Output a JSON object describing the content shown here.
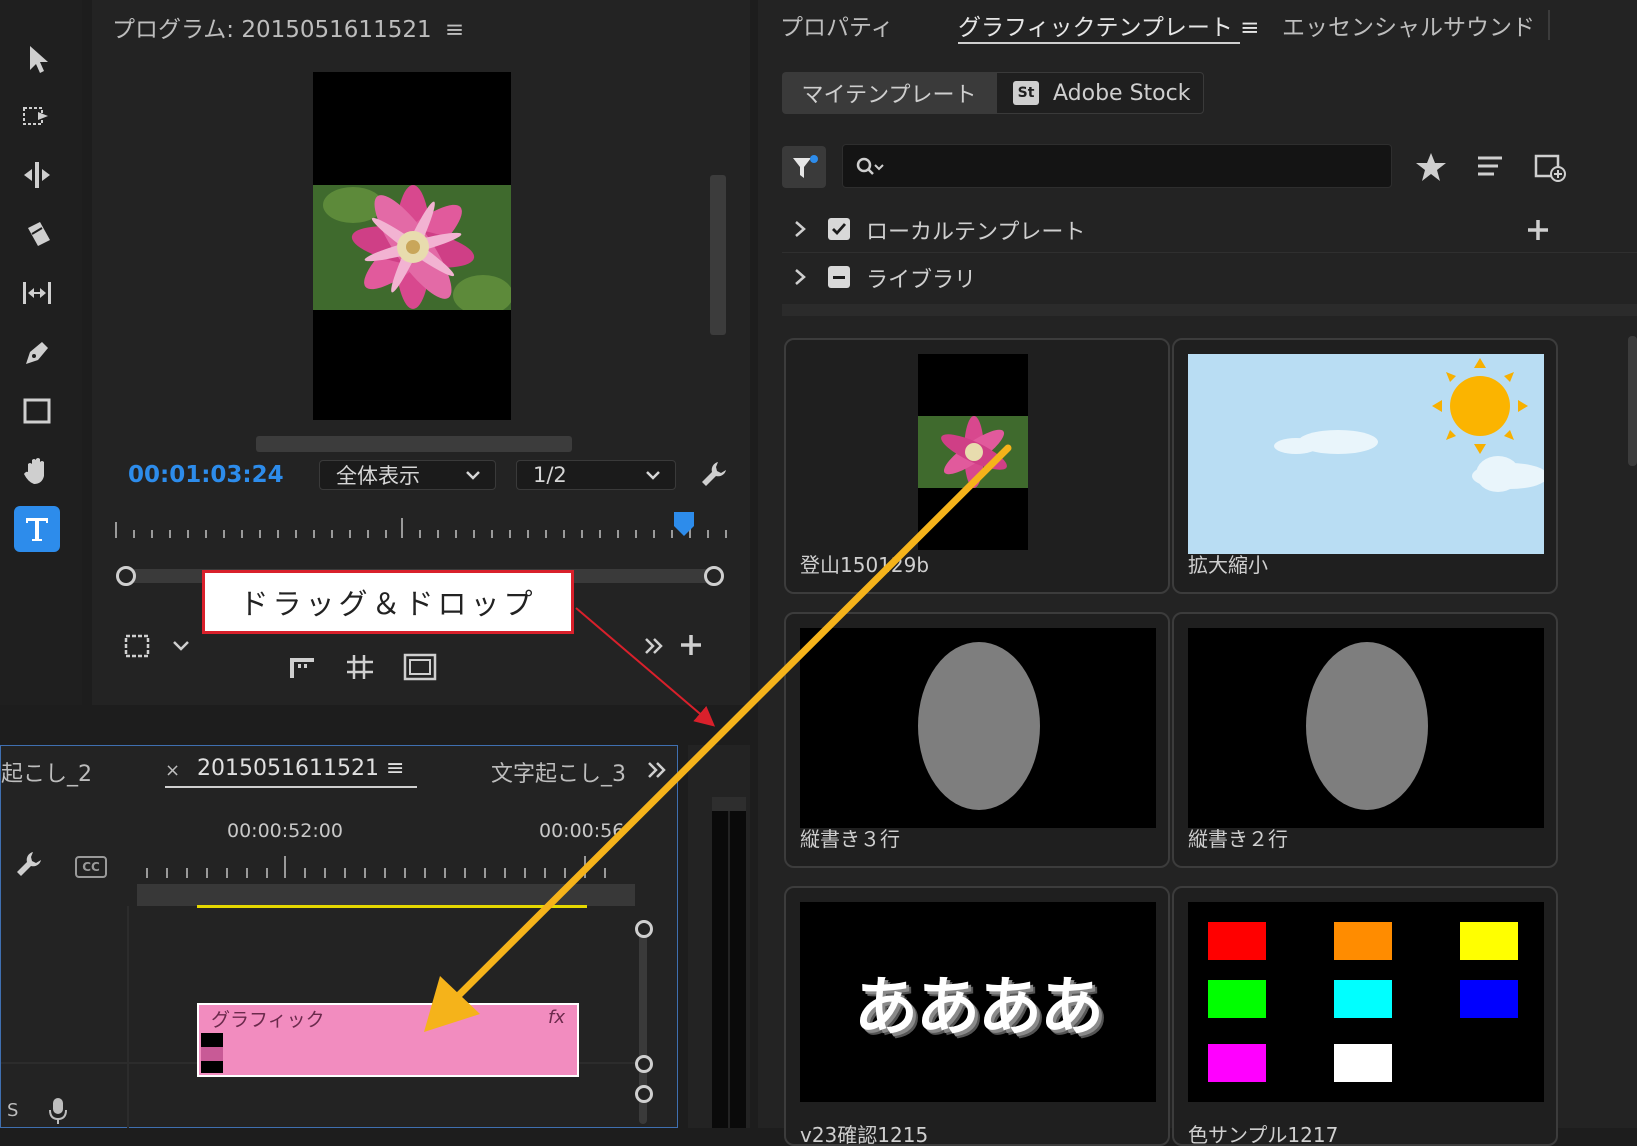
{
  "program_monitor": {
    "title": "プログラム: 2015051611521",
    "timecode": "00:01:03:24",
    "zoom_select": "全体表示",
    "resolution_select": "1/2"
  },
  "panel_tabs": {
    "properties": "プロパティ",
    "graphics_templates": "グラフィックテンプレート",
    "essential_sound": "エッセンシャルサウンド"
  },
  "template_source": {
    "my_templates": "マイテンプレート",
    "adobe_stock_badge": "St",
    "adobe_stock": "Adobe Stock"
  },
  "search": {
    "placeholder": ""
  },
  "folders": [
    {
      "label": "ローカルテンプレート"
    },
    {
      "label": "ライブラリ"
    }
  ],
  "templates": [
    {
      "label": "登山150129b"
    },
    {
      "label": "拡大縮小"
    },
    {
      "label": "縦書き３行"
    },
    {
      "label": "縦書き２行"
    },
    {
      "label": "v23確認1215",
      "thumb_text": "ああああ"
    },
    {
      "label": "色サンプル1217"
    }
  ],
  "timeline": {
    "tab_left": "起こし_2",
    "tab_active": "2015051611521",
    "tab_right": "文字起こし_3",
    "ruler_time_1": "00:00:52:00",
    "ruler_time_2": "00:00:56",
    "cc_label": "CC",
    "clip_label": "グラフィック",
    "clip_fx": "fx",
    "track_label_s": "S"
  },
  "annotation": {
    "callout": "ドラッグ＆ドロップ"
  },
  "colors": {
    "accent_blue": "#2d8ceb",
    "clip_pink": "#f28cbf",
    "arrow_orange": "#f5b31a",
    "callout_red": "#d9202b",
    "work_area_yellow": "#e5d800"
  },
  "swatches": [
    "#ff0000",
    "#ff8c00",
    "#ffff00",
    "#00ff00",
    "#00ffff",
    "#0000ff",
    "#ff00ff",
    "#ffffff"
  ]
}
